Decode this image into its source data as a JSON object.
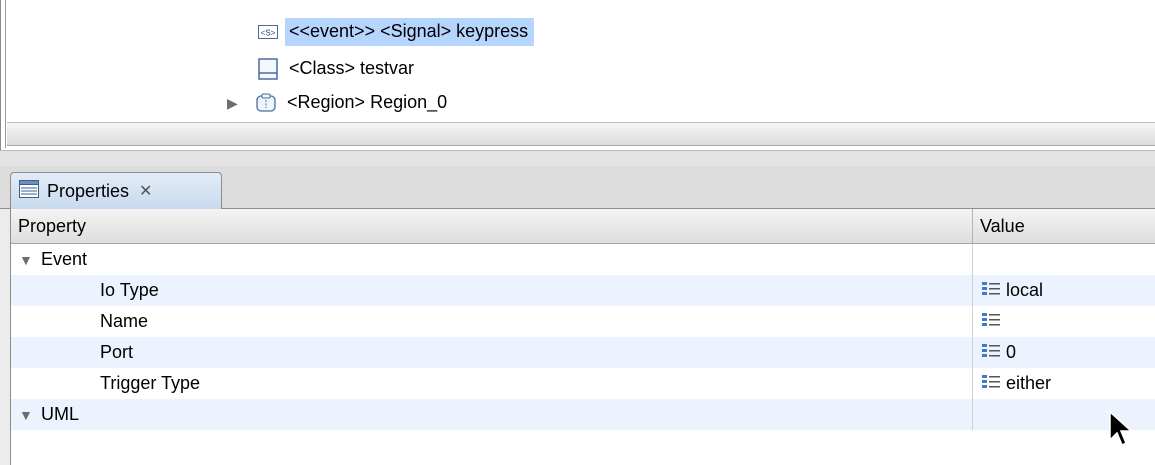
{
  "tree": {
    "items": [
      {
        "label": "<<event>> <Signal> keypress",
        "icon": "signal-icon",
        "selected": true
      },
      {
        "label": "<Class> testvar",
        "icon": "class-icon",
        "selected": false
      },
      {
        "label": "<Region> Region_0",
        "icon": "region-icon",
        "selected": false,
        "expandable": true
      }
    ]
  },
  "properties_view": {
    "tab_label": "Properties",
    "columns": {
      "property": "Property",
      "value": "Value"
    },
    "rows": [
      {
        "label": "Event",
        "group": true,
        "value": ""
      },
      {
        "label": "Io Type",
        "value": "local"
      },
      {
        "label": "Name",
        "value": ""
      },
      {
        "label": "Port",
        "value": "0"
      },
      {
        "label": "Trigger Type",
        "value": "either"
      },
      {
        "label": "UML",
        "group": true,
        "value": ""
      }
    ]
  }
}
